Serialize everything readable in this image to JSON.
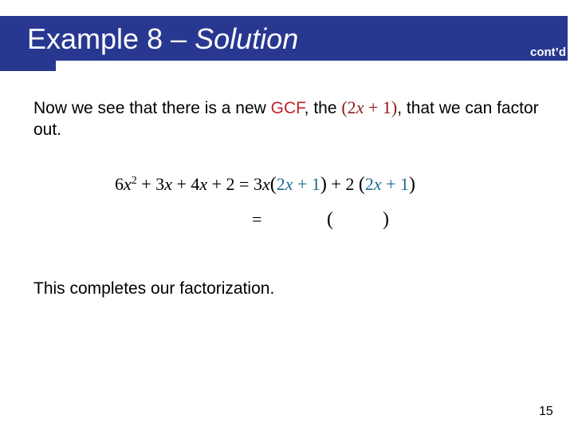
{
  "header": {
    "title_main": "Example 8 – ",
    "title_italic": "Solution",
    "continued_label": "cont’d",
    "bar_color": "#283891"
  },
  "body": {
    "paragraph": {
      "before": "Now we see that there is a new ",
      "gcf": "GCF",
      "middle": ", the ",
      "expr_open": "(2",
      "expr_var": "x",
      "expr_close": " + 1)",
      "after": ", that we can factor out."
    },
    "equation_line1": {
      "lhs_coef": "6",
      "lhs_var1": "x",
      "lhs_exp": "2",
      "lhs_rest1": " + 3",
      "lhs_var2": "x",
      "lhs_rest2": " + 4",
      "lhs_var3": "x",
      "lhs_rest3": " + 2 = ",
      "term1_coef": "3",
      "term1_var": "x",
      "open1": "(",
      "inner1_a": "2",
      "inner1_var": "x",
      "inner1_b": " + 1",
      "close1": ")",
      "plus": " + 2 ",
      "open2": "(",
      "inner2_a": "2",
      "inner2_var": "x",
      "inner2_b": " + 1",
      "close2": ")"
    },
    "equation_line2": {
      "equals": "=",
      "open": "(",
      "close": ")"
    },
    "conclusion": "This completes our factorization."
  },
  "colors": {
    "gcf": "#c0232c",
    "highlight_expr": "#8b1a1a",
    "inner_factor": "#1f6a8f"
  },
  "footer": {
    "page_number": "15"
  }
}
